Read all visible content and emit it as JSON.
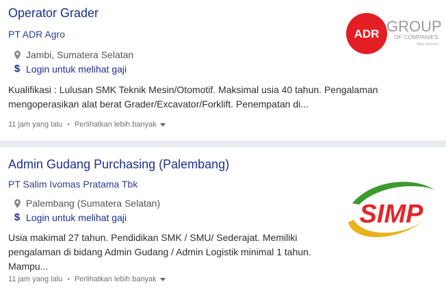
{
  "jobs": [
    {
      "title": "Operator Grader",
      "company": "PT ADR Agro",
      "location": "Jambi, Sumatera Selatan",
      "salary_link": "Login untuk melihat gaji",
      "description_line1": "Kualifikasi : Lulusan SMK Teknik Mesin/Otomotif. Maksimal usia 40 tahun. Pengalaman",
      "description_line2": "mengoperasikan alat berat Grader/Excavator/Forklift. Penempatan di...",
      "posted": "11 jam yang lalu",
      "more_label": "Perlihatkan lebih banyak",
      "logo": {
        "circle_text": "ADR",
        "group_text": "GROUP",
        "sub_text": "OF COMPANIES",
        "division_text": "Agro Division",
        "brand_color": "#e31e24"
      }
    },
    {
      "title": "Admin Gudang Purchasing (Palembang)",
      "company": "PT Salim Ivomas Pratama Tbk",
      "location": "Palembang (Sumatera Selatan)",
      "salary_link": "Login untuk melihat gaji",
      "description_line1": "Usia makimal 27 tahun. Pendidikan SMK / SMU/ Sederajat. Memiliki",
      "description_line2": "pengalaman di bidang Admin Gudang / Admin Logistik minimal 1 tahun.",
      "description_line3": "Mampu...",
      "posted": "11 jam yang lalu",
      "more_label": "Perlihatkan lebih banyak",
      "logo": {
        "text": "SIMP",
        "brand_color": "#e3262b",
        "swoosh_green": "#3d9a2f",
        "swoosh_yellow": "#e8b21a"
      }
    }
  ]
}
